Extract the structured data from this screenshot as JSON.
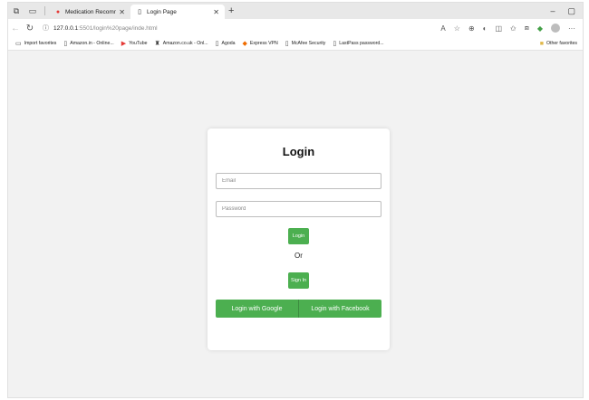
{
  "browser": {
    "tabs": [
      {
        "label": "Medication Recommendati",
        "favicon": "red-record-icon",
        "active": false
      },
      {
        "label": "Login Page",
        "favicon": "page-icon",
        "active": true
      }
    ],
    "new_tab_glyph": "+",
    "window_controls": {
      "minimize": "–",
      "restore": "▢"
    },
    "url_host": "127.0.0.1",
    "url_rest": ":5501/login%20page/inde.html",
    "favorites": [
      {
        "label": "Import favorites",
        "icon": "import-icon"
      },
      {
        "label": "Amazon.in - Online...",
        "icon": "page-icon"
      },
      {
        "label": "YouTube",
        "icon": "youtube-icon"
      },
      {
        "label": "Amazon.co.uk - Onl...",
        "icon": "amazon-icon"
      },
      {
        "label": "Agoda",
        "icon": "page-icon"
      },
      {
        "label": "Express VPN",
        "icon": "vpn-icon"
      },
      {
        "label": "McAfee Security",
        "icon": "page-icon"
      },
      {
        "label": "LastPass password...",
        "icon": "page-icon"
      }
    ],
    "other_favorites": "Other favorites"
  },
  "login": {
    "title": "Login",
    "email_placeholder": "Email",
    "password_placeholder": "Password",
    "login_button": "Login",
    "or_text": "Or",
    "signin_button": "Sign In",
    "google_button": "Login with Google",
    "facebook_button": "Login with Facebook"
  },
  "colors": {
    "button_green": "#4caf50",
    "page_background": "#f2f2f2"
  }
}
